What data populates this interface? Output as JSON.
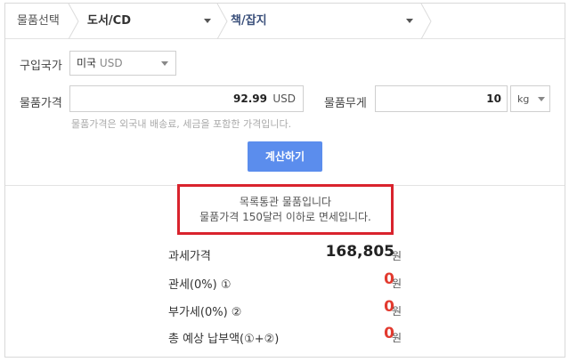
{
  "breadcrumb": {
    "label": "물품선택",
    "category": "도서/CD",
    "subcategory": "책/잡지"
  },
  "form": {
    "country_label": "구입국가",
    "country_value": "미국",
    "country_currency": "USD",
    "price_label": "물품가격",
    "price_value": "92.99",
    "price_unit": "USD",
    "price_hint": "물품가격은 외국내 배송료, 세금을 포함한 가격입니다.",
    "weight_label": "물품무게",
    "weight_value": "10",
    "weight_unit": "kg",
    "calc_button": "계산하기"
  },
  "notice": {
    "line1": "목록통관 물품입니다",
    "line2": "물품가격 150달러 이하로 면세입니다."
  },
  "results": [
    {
      "label": "과세가격",
      "value": "168,805",
      "unit": "원"
    },
    {
      "label": "관세(0%) ①",
      "value": "0",
      "unit": "원"
    },
    {
      "label": "부가세(0%) ②",
      "value": "0",
      "unit": "원"
    },
    {
      "label": "총 예상 납부액(①+②)",
      "value": "0",
      "unit": "원"
    }
  ],
  "colors": {
    "button": "#5b8ded",
    "notice_border": "#d9232d",
    "zero_value": "#e23a2f"
  }
}
